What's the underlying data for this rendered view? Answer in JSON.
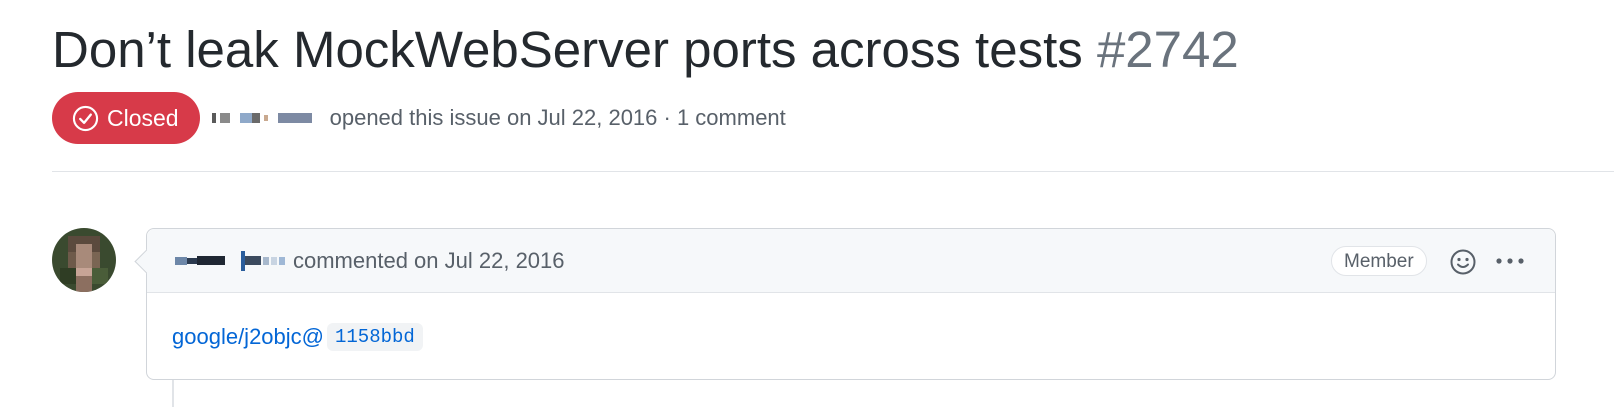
{
  "issue": {
    "title": "Don’t leak MockWebServer ports across tests",
    "number": "#2742",
    "state_label": "Closed",
    "state_color": "#d73a49",
    "meta_text": "opened this issue on Jul 22, 2016 · 1 comment"
  },
  "comment": {
    "action_text": "commented on Jul 22, 2016",
    "role_badge": "Member",
    "body_link": "google/j2objc@",
    "commit_sha": "1158bbd"
  },
  "icons": {
    "state": "circle-check-icon",
    "emoji": "smiley-icon",
    "more": "kebab-horizontal-icon"
  },
  "colors": {
    "link": "#0366d6",
    "muted_text": "#586069",
    "header_bg": "#f6f8fa"
  }
}
